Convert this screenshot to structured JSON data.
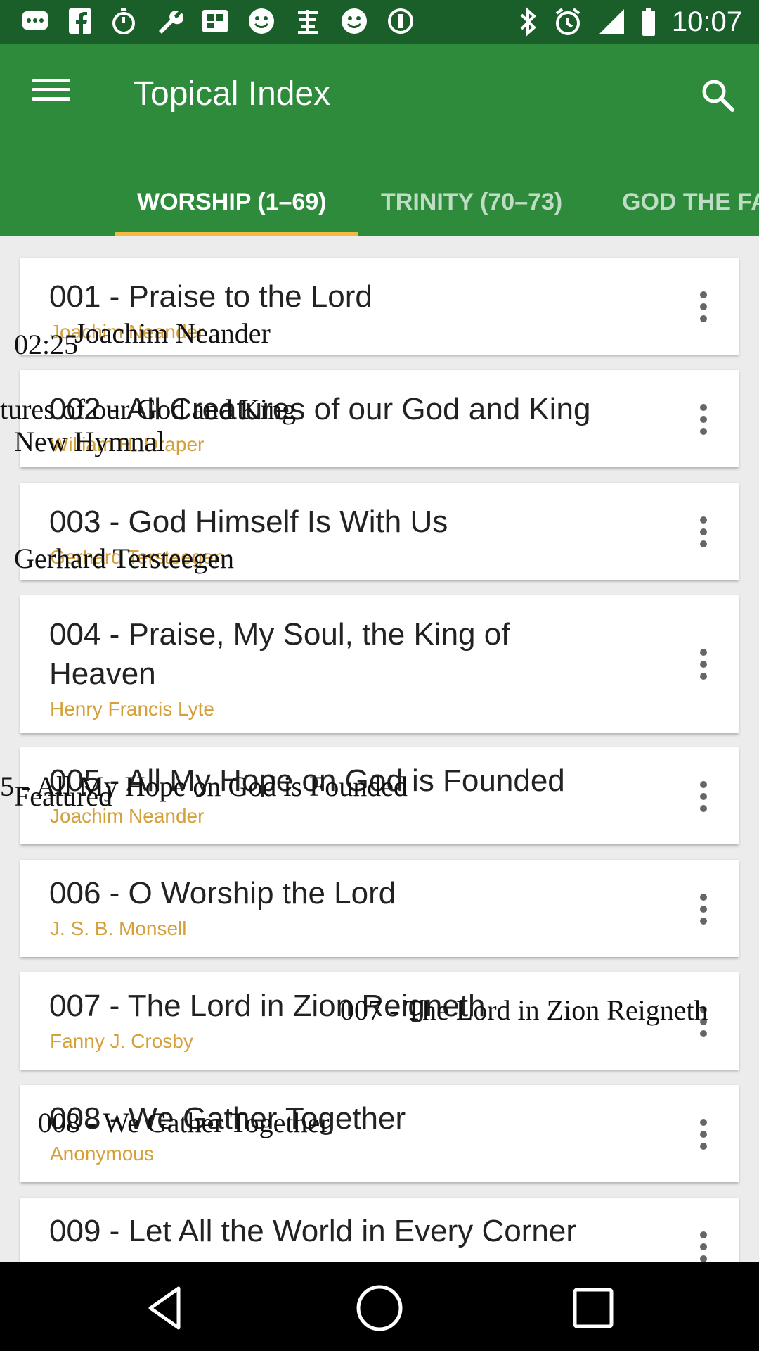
{
  "status_bar": {
    "time": "10:07",
    "icons": [
      "message-icon",
      "facebook-icon",
      "timer-icon",
      "wrench-icon",
      "qr-icon",
      "smiley-icon",
      "chinese-char-icon",
      "smiley-icon",
      "data-saver-icon",
      "bluetooth-icon",
      "alarm-icon",
      "signal-icon",
      "battery-icon"
    ],
    "color": "#1a5e2a"
  },
  "app_bar": {
    "title": "Topical Index",
    "color": "#2e8b3c",
    "menu_icon": "hamburger-menu-icon",
    "search_icon": "search-icon"
  },
  "tabs": [
    {
      "label": "WORSHIP (1–69)",
      "active": true
    },
    {
      "label": "TRINITY (70–73)",
      "active": false
    },
    {
      "label": "GOD THE FA",
      "active": false
    }
  ],
  "accent_color": "#f4b942",
  "author_color": "#d4a03a",
  "hymns": [
    {
      "title": "001 - Praise to the Lord",
      "author": "Joachim Neander"
    },
    {
      "title": "002 - All Creatures of our God and King",
      "author": "William H. Draper"
    },
    {
      "title": "003 - God Himself Is With Us",
      "author": "Gerhard Tersteegen"
    },
    {
      "title": "004 - Praise, My Soul, the King of",
      "title_line2": "Heaven",
      "author": "Henry Francis Lyte"
    },
    {
      "title": "005 - All My Hope on God is Founded",
      "author": "Joachim Neander"
    },
    {
      "title": "006 - O Worship the Lord",
      "author": "J. S. B. Monsell"
    },
    {
      "title": "007 - The Lord in Zion Reigneth",
      "author": "Fanny J. Crosby"
    },
    {
      "title": "008 - We Gather Together",
      "author": "Anonymous"
    },
    {
      "title": "009 - Let All the World in Every Corner",
      "author": ""
    }
  ],
  "overlay_texts": {
    "t1": "02:25",
    "t2": "Joachim Neander",
    "t3": "tures of our God and King",
    "t4": "New Hymnal",
    "t5": "Gerhard Tersteegen",
    "t6": "5 - All My Hope on God is Founded",
    "t7": "Featured",
    "t8": "007 - The Lord in Zion Reigneth",
    "t9": "008 - We Gather Together"
  },
  "nav_bar": {
    "back_icon": "back-triangle-icon",
    "home_icon": "home-circle-icon",
    "recents_icon": "recents-square-icon"
  }
}
